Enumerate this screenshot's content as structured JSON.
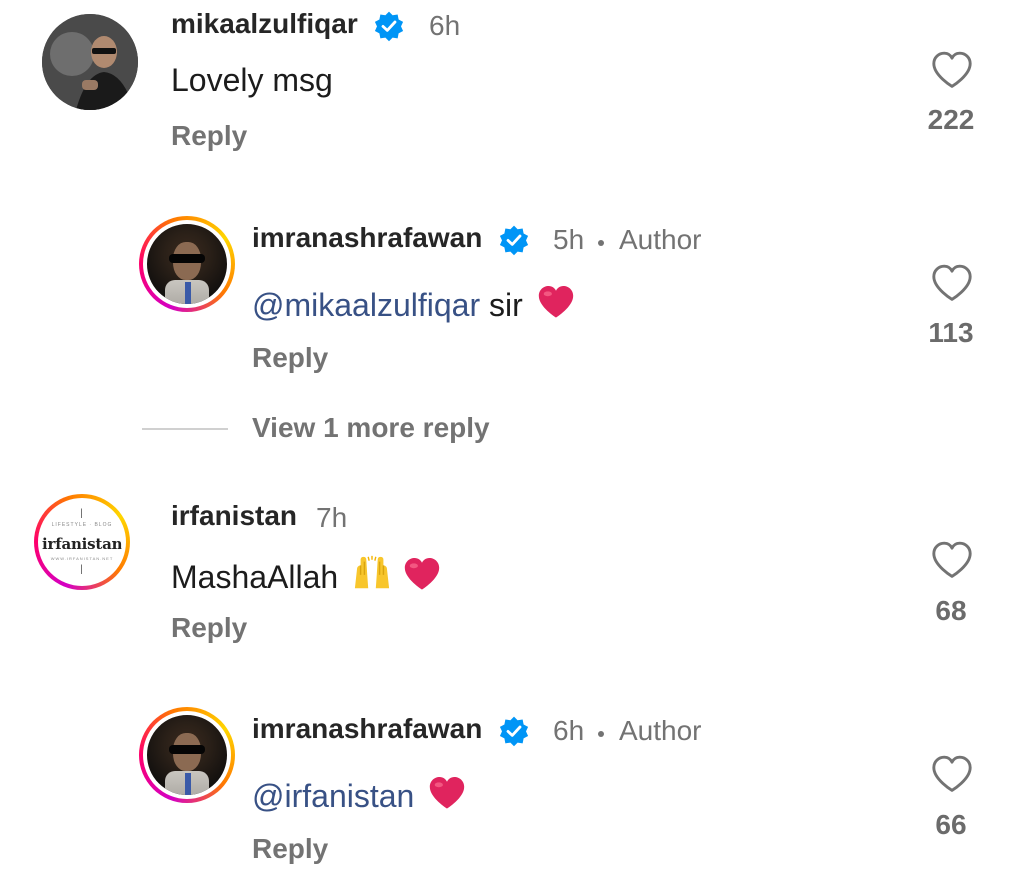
{
  "comments": [
    {
      "username": "mikaalzulfiqar",
      "verified": true,
      "time": "6h",
      "text": "Lovely msg",
      "reply_label": "Reply",
      "likes": "222",
      "avatar": "photo-avatar"
    },
    {
      "username": "imranashrafawan",
      "verified": true,
      "time": "5h",
      "author_label": "Author",
      "mention": "@mikaalzulfiqar",
      "text": "sir",
      "emoji": "red-heart",
      "reply_label": "Reply",
      "likes": "113",
      "avatar": "ring-avatar"
    },
    {
      "username": "irfanistan",
      "verified": false,
      "time": "7h",
      "text": "MashaAllah",
      "emojis": [
        "raising-hands",
        "red-heart"
      ],
      "reply_label": "Reply",
      "likes": "68",
      "avatar": "logo-avatar",
      "logo_text": "irfanistan",
      "logo_tagline": "LIFESTYLE · BLOG",
      "logo_url": "WWW.IRFANISTAN.NET"
    },
    {
      "username": "imranashrafawan",
      "verified": true,
      "time": "6h",
      "author_label": "Author",
      "mention": "@irfanistan",
      "emoji": "red-heart",
      "reply_label": "Reply",
      "likes": "66",
      "avatar": "ring-avatar"
    }
  ],
  "view_more_replies": "View 1 more reply",
  "colors": {
    "verified_blue": "#0095f6",
    "heart_red": "#e0245e",
    "mention_blue": "#385185",
    "muted_gray": "#737373"
  }
}
